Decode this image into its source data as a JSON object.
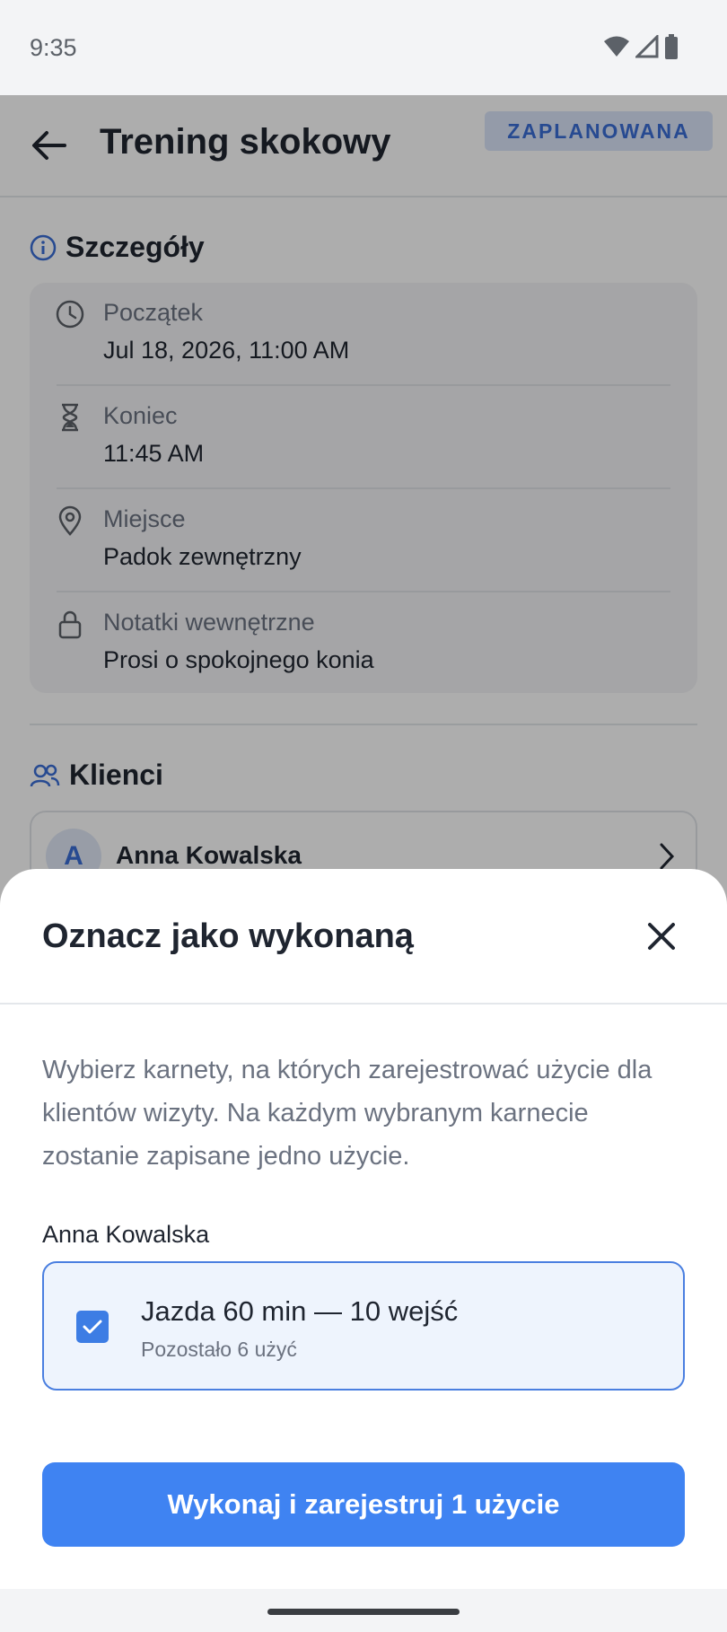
{
  "status_bar": {
    "time": "9:35",
    "icons": [
      "wifi-icon",
      "signal-icon",
      "battery-icon"
    ]
  },
  "header": {
    "title": "Trening skokowy",
    "status_chip": "ZAPLANOWANA"
  },
  "details": {
    "heading": "Szczegóły",
    "rows": [
      {
        "icon": "clock-icon",
        "label": "Początek",
        "value": "Jul 18, 2026, 11:00 AM"
      },
      {
        "icon": "hourglass-icon",
        "label": "Koniec",
        "value": "11:45 AM"
      },
      {
        "icon": "location-pin-icon",
        "label": "Miejsce",
        "value": "Padok zewnętrzny"
      },
      {
        "icon": "lock-icon",
        "label": "Notatki wewnętrzne",
        "value": "Prosi o spokojnego konia"
      }
    ]
  },
  "clients": {
    "heading": "Klienci",
    "items": [
      {
        "avatar_letter": "A",
        "name": "Anna Kowalska"
      }
    ]
  },
  "sheet": {
    "title": "Oznacz jako wykonaną",
    "description": "Wybierz karnety, na których zarejestrować użycie dla klientów wizyty. Na każdym wybranym karnecie zostanie zapisane jedno użycie.",
    "client_name": "Anna Kowalska",
    "pass": {
      "name": "Jazda 60 min — 10 wejść",
      "remaining": "Pozostało 6 użyć",
      "checked": true
    },
    "confirm_label": "Wykonaj i zarejestruj 1 użycie"
  },
  "colors": {
    "primary": "#3f83f2",
    "chip_bg": "#dbe5f9",
    "chip_text": "#3a6ed6",
    "text_primary": "#1f2530",
    "text_secondary": "#6b7280"
  }
}
